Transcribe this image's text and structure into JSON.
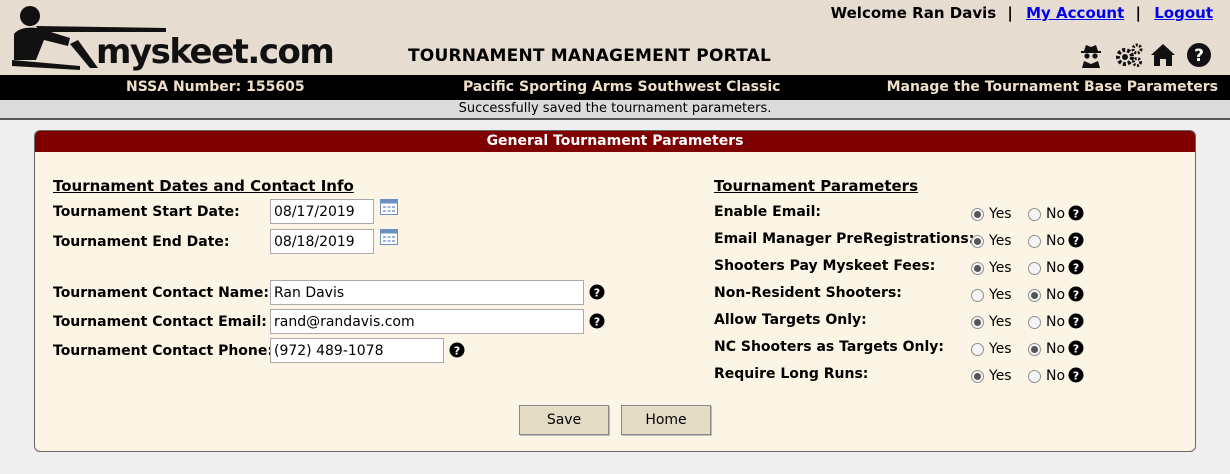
{
  "header": {
    "logo_text": "myskeet.com",
    "portal_title": "TOURNAMENT MANAGEMENT PORTAL",
    "welcome": "Welcome Ran Davis",
    "my_account": "My Account",
    "logout": "Logout",
    "icons": [
      "spy-icon",
      "gears-icon",
      "home-icon",
      "help-icon"
    ]
  },
  "infobar": {
    "nssa": "NSSA Number: 155605",
    "event": "Pacific Sporting Arms Southwest Classic",
    "page": "Manage the Tournament Base Parameters"
  },
  "status": "Successfully saved the tournament parameters.",
  "panel": {
    "title": "General Tournament Parameters",
    "left": {
      "section_title": "Tournament Dates and Contact Info",
      "start_label": "Tournament Start Date:",
      "start_value": "08/17/2019",
      "end_label": "Tournament End Date:",
      "end_value": "08/18/2019",
      "name_label": "Tournament Contact Name:",
      "name_value": "Ran Davis",
      "email_label": "Tournament Contact Email:",
      "email_value": "rand@randavis.com",
      "phone_label": "Tournament Contact Phone:",
      "phone_value": "(972) 489-1078"
    },
    "right": {
      "section_title": "Tournament Parameters",
      "yes": "Yes",
      "no": "No",
      "params": [
        {
          "label": "Enable Email:",
          "value": "Yes"
        },
        {
          "label": "Email Manager PreRegistrations:",
          "value": "Yes"
        },
        {
          "label": "Shooters Pay Myskeet Fees:",
          "value": "Yes"
        },
        {
          "label": "Non-Resident Shooters:",
          "value": "No"
        },
        {
          "label": "Allow Targets Only:",
          "value": "Yes"
        },
        {
          "label": "NC Shooters as Targets Only:",
          "value": "No"
        },
        {
          "label": "Require Long Runs:",
          "value": "Yes"
        }
      ]
    },
    "buttons": {
      "save": "Save",
      "home": "Home"
    }
  },
  "colors": {
    "header_bg": "#e6dcd0",
    "infobar_bg": "#000000",
    "infobar_text": "#eedfc9",
    "panel_head": "#7e0000",
    "panel_bg": "#fcf4e4",
    "link": "#0000ee"
  }
}
